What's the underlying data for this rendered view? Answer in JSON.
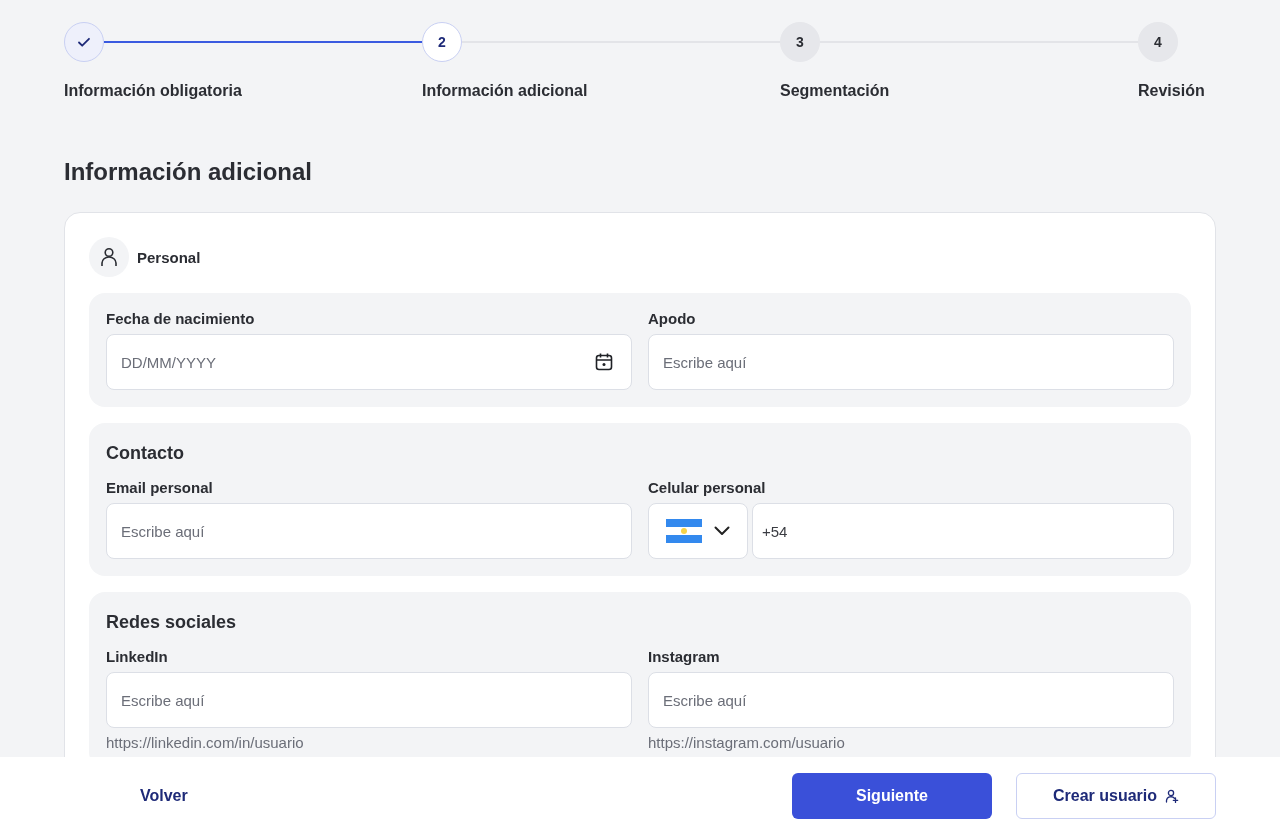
{
  "stepper": {
    "steps": [
      {
        "label": "Información obligatoria",
        "completed": true,
        "selected": false
      },
      {
        "number": "2",
        "label": "Información adicional",
        "completed": false,
        "selected": true
      },
      {
        "number": "3",
        "label": "Segmentación",
        "completed": false,
        "selected": false
      },
      {
        "number": "4",
        "label": "Revisión",
        "completed": false,
        "selected": false
      }
    ]
  },
  "page_title": "Información adicional",
  "card": {
    "title": "Personal",
    "groups": [
      {
        "fields": [
          {
            "kind": "date",
            "label": "Fecha de nacimiento",
            "placeholder": "DD/MM/YYYY"
          },
          {
            "kind": "text",
            "label": "Apodo",
            "placeholder": "Escribe aquí"
          }
        ]
      },
      {
        "title": "Contacto",
        "fields": [
          {
            "kind": "text",
            "label": "Email personal",
            "placeholder": "Escribe aquí"
          },
          {
            "kind": "phone",
            "label": "Celular personal",
            "value": "+54"
          }
        ]
      },
      {
        "title": "Redes sociales",
        "fields": [
          {
            "kind": "text",
            "label": "LinkedIn",
            "placeholder": "Escribe aquí",
            "helper": "https://linkedin.com/in/usuario"
          },
          {
            "kind": "text",
            "label": "Instagram",
            "placeholder": "Escribe aquí",
            "helper": "https://instagram.com/usuario"
          }
        ]
      }
    ]
  },
  "footer": {
    "back": "Volver",
    "next": "Siguiente",
    "create": "Crear usuario"
  }
}
